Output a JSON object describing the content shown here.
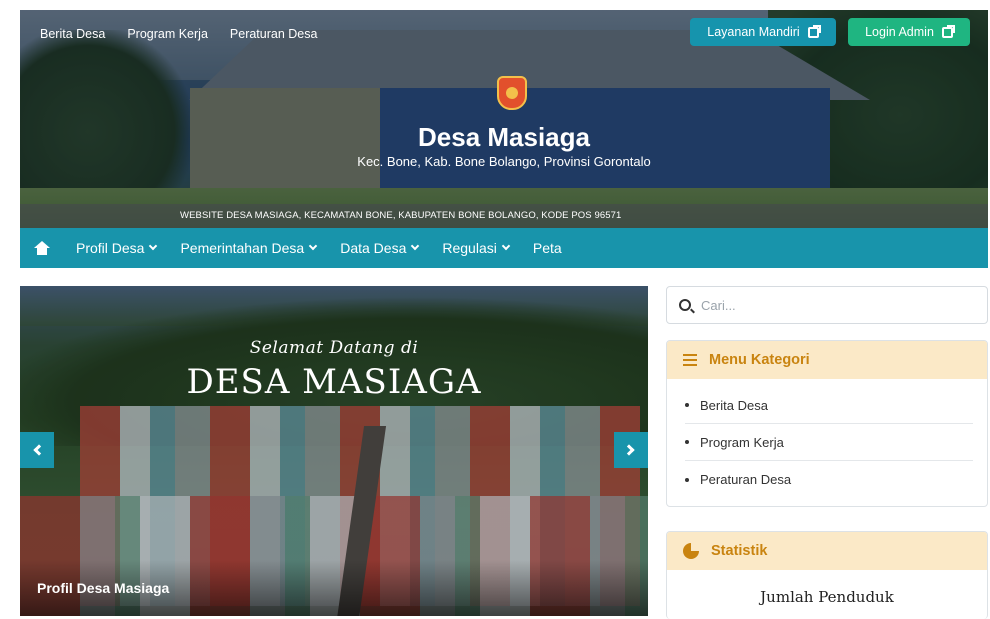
{
  "top_nav": [
    "Berita Desa",
    "Program Kerja",
    "Peraturan Desa"
  ],
  "buttons": {
    "layanan": "Layanan Mandiri",
    "login": "Login Admin"
  },
  "site": {
    "title": "Desa Masiaga",
    "subtitle": "Kec. Bone, Kab. Bone Bolango, Provinsi Gorontalo",
    "banner": "WEBSITE DESA MASIAGA, KECAMATAN BONE, KABUPATEN BONE BOLANGO, KODE POS 96571"
  },
  "main_nav": [
    {
      "label": "Profil Desa",
      "dropdown": true
    },
    {
      "label": "Pemerintahan Desa",
      "dropdown": true
    },
    {
      "label": "Data Desa",
      "dropdown": true
    },
    {
      "label": "Regulasi",
      "dropdown": true
    },
    {
      "label": "Peta",
      "dropdown": false
    }
  ],
  "slider": {
    "welcome": "Selamat Datang di",
    "name": "DESA MASIAGA",
    "caption": "Profil Desa Masiaga"
  },
  "search": {
    "placeholder": "Cari..."
  },
  "menu_kategori": {
    "title": "Menu Kategori",
    "items": [
      "Berita Desa",
      "Program Kerja",
      "Peraturan Desa"
    ]
  },
  "statistik": {
    "title": "Statistik",
    "label": "Jumlah Penduduk"
  },
  "colors": {
    "accent": "#1894ab",
    "login": "#1fb581",
    "card_head": "#fbe9c7",
    "card_title": "#c98410"
  }
}
